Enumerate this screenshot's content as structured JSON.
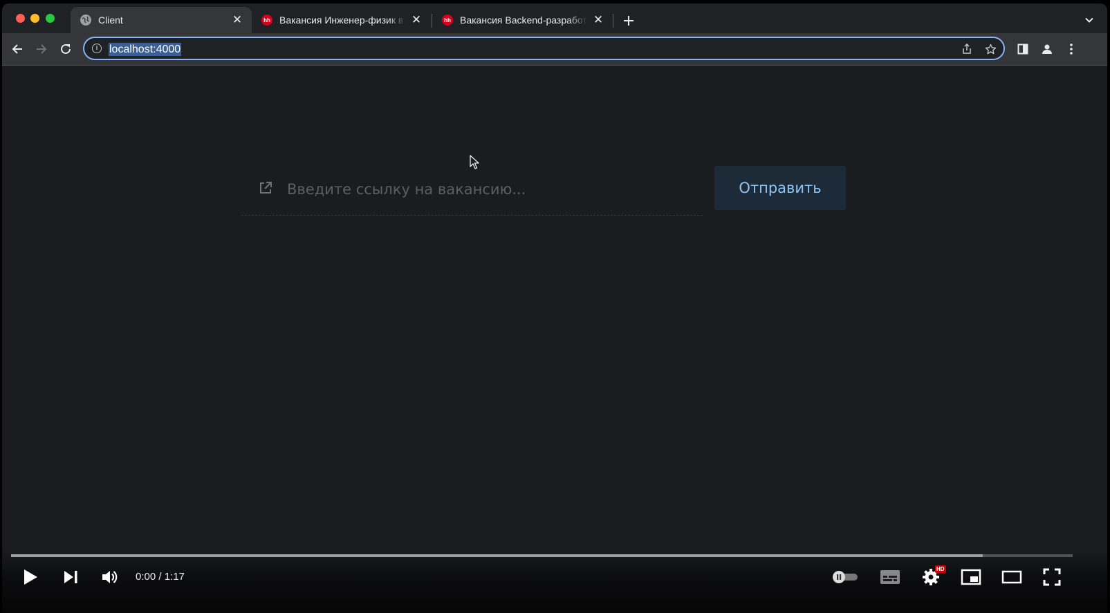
{
  "browser": {
    "tabs": [
      {
        "title": "Client",
        "favicon": "globe-icon",
        "active": true
      },
      {
        "title": "Вакансия Инженер-физик в Москве",
        "favicon": "hh-icon",
        "active": false
      },
      {
        "title": "Вакансия Backend-разработчик",
        "favicon": "hh-icon",
        "active": false
      }
    ],
    "hh_favicon_text": "hh",
    "url": "localhost:4000"
  },
  "page": {
    "search": {
      "placeholder": "Введите ссылку на вакансию...",
      "value": ""
    },
    "submit_label": "Отправить"
  },
  "player": {
    "time": "0:00 / 1:17",
    "played_fraction": 0.0,
    "buffered_fraction": 0.915,
    "hd_badge": "HD",
    "colors": {
      "progress_played": "#ff0000",
      "hd_badge": "#cc0000"
    }
  },
  "colors": {
    "page_background": "#1b1c1f",
    "button_background": "#1d2a38",
    "button_text": "#8fc6f5",
    "omnibox_focus": "#8ab4f8"
  }
}
